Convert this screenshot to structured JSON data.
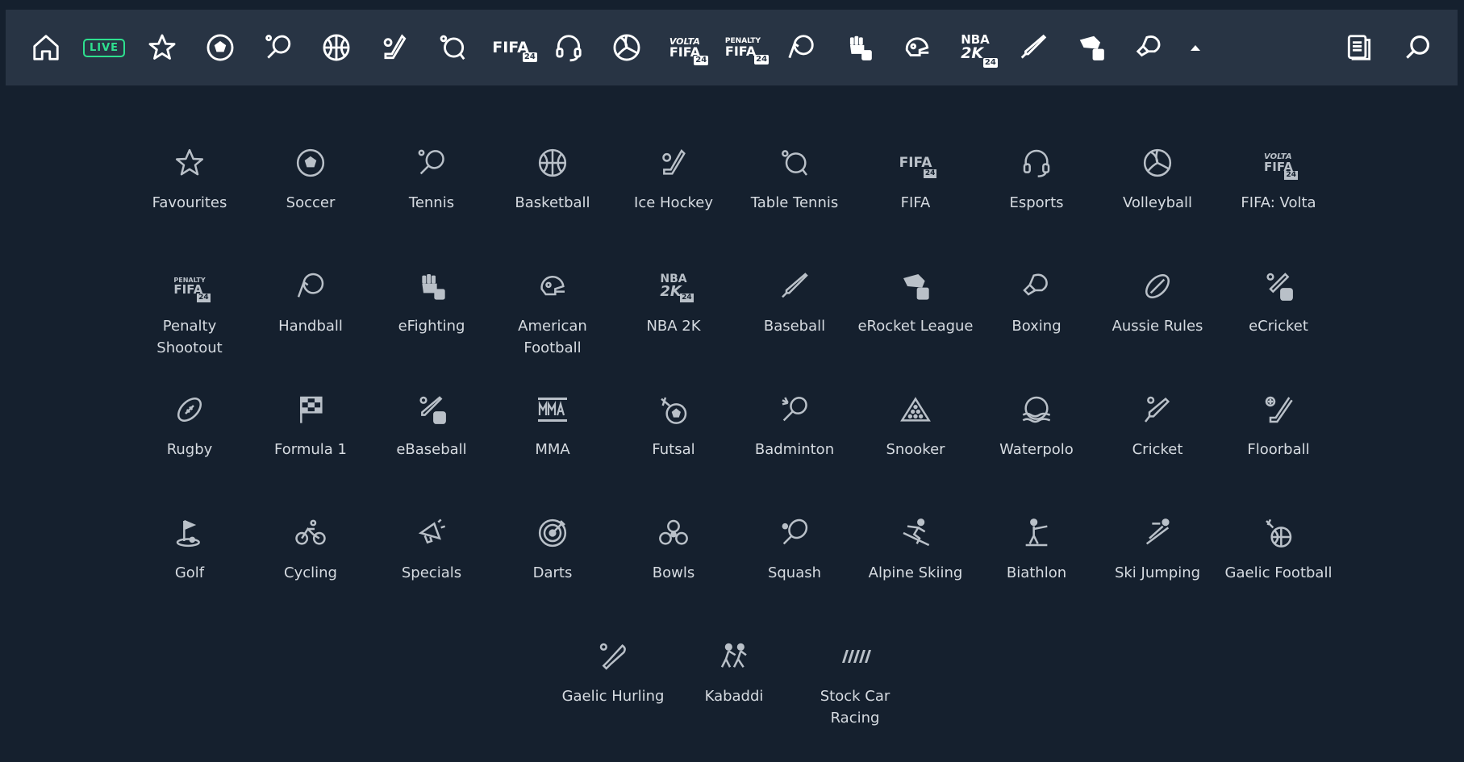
{
  "nav": {
    "live_label": "LIVE",
    "fifa_top": "FIFA",
    "fifa_sub": "24",
    "volta_top": "VOLTA",
    "penalty_top": "PENALTY",
    "nba_top": "NBA",
    "nba_mid": "2K"
  },
  "sports": [
    {
      "label": "Favourites",
      "icon": "star-icon"
    },
    {
      "label": "Soccer",
      "icon": "soccer-ball-icon"
    },
    {
      "label": "Tennis",
      "icon": "tennis-racket-icon"
    },
    {
      "label": "Basketball",
      "icon": "basketball-icon"
    },
    {
      "label": "Ice Hockey",
      "icon": "ice-hockey-icon"
    },
    {
      "label": "Table Tennis",
      "icon": "table-tennis-icon"
    },
    {
      "label": "FIFA",
      "icon": "fifa-icon"
    },
    {
      "label": "Esports",
      "icon": "headset-icon"
    },
    {
      "label": "Volleyball",
      "icon": "volleyball-icon"
    },
    {
      "label": "FIFA: Volta",
      "icon": "fifa-volta-icon"
    },
    {
      "label": "Penalty Shootout",
      "icon": "penalty-fifa-icon"
    },
    {
      "label": "Handball",
      "icon": "handball-icon"
    },
    {
      "label": "eFighting",
      "icon": "fist-icon"
    },
    {
      "label": "American Football",
      "icon": "football-helmet-icon"
    },
    {
      "label": "NBA 2K",
      "icon": "nba-2k-icon"
    },
    {
      "label": "Baseball",
      "icon": "baseball-bat-icon"
    },
    {
      "label": "eRocket League",
      "icon": "rocket-car-icon"
    },
    {
      "label": "Boxing",
      "icon": "boxing-glove-icon"
    },
    {
      "label": "Aussie Rules",
      "icon": "aussie-rules-ball-icon"
    },
    {
      "label": "eCricket",
      "icon": "ecricket-icon"
    },
    {
      "label": "Rugby",
      "icon": "rugby-ball-icon"
    },
    {
      "label": "Formula 1",
      "icon": "checkered-flag-icon"
    },
    {
      "label": "eBaseball",
      "icon": "ebaseball-icon"
    },
    {
      "label": "MMA",
      "icon": "mma-icon"
    },
    {
      "label": "Futsal",
      "icon": "futsal-icon"
    },
    {
      "label": "Badminton",
      "icon": "badminton-icon"
    },
    {
      "label": "Snooker",
      "icon": "snooker-icon"
    },
    {
      "label": "Waterpolo",
      "icon": "waterpolo-icon"
    },
    {
      "label": "Cricket",
      "icon": "cricket-bat-icon"
    },
    {
      "label": "Floorball",
      "icon": "floorball-icon"
    },
    {
      "label": "Golf",
      "icon": "golf-flag-icon"
    },
    {
      "label": "Cycling",
      "icon": "bicycle-icon"
    },
    {
      "label": "Specials",
      "icon": "megaphone-icon"
    },
    {
      "label": "Darts",
      "icon": "dartboard-icon"
    },
    {
      "label": "Bowls",
      "icon": "bowls-icon"
    },
    {
      "label": "Squash",
      "icon": "squash-racket-icon"
    },
    {
      "label": "Alpine Skiing",
      "icon": "alpine-skier-icon"
    },
    {
      "label": "Biathlon",
      "icon": "biathlon-icon"
    },
    {
      "label": "Ski Jumping",
      "icon": "ski-jumping-icon"
    },
    {
      "label": "Gaelic Football",
      "icon": "gaelic-football-icon"
    }
  ],
  "last_row": [
    {
      "label": "Gaelic Hurling",
      "icon": "hurling-icon"
    },
    {
      "label": "Kabaddi",
      "icon": "kabaddi-icon"
    },
    {
      "label": "Stock Car Racing",
      "icon": "stock-car-icon"
    }
  ],
  "colors": {
    "background": "#15202e",
    "topbar": "#283444",
    "live_accent": "#2ee08f",
    "icon": "#b9c0c8"
  }
}
